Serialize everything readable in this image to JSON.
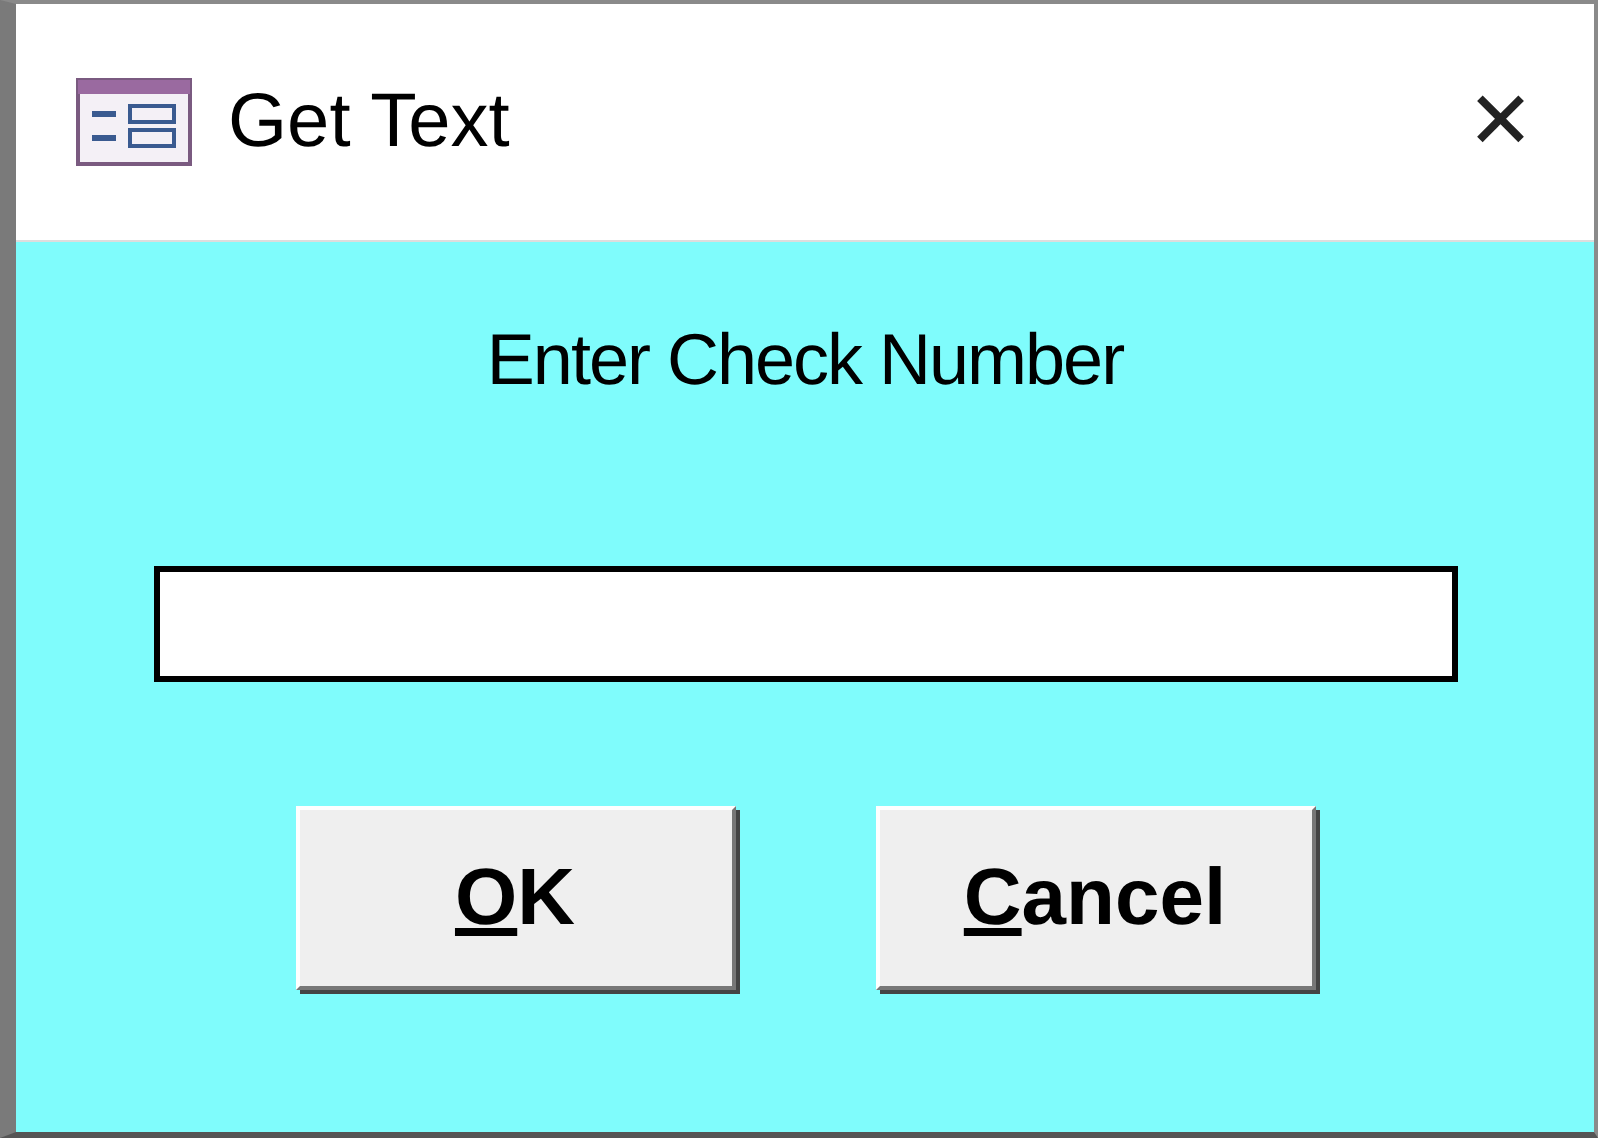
{
  "window": {
    "title": "Get Text",
    "close": "✕"
  },
  "prompt": "Enter Check Number",
  "buttons": [
    {
      "mnemonic": "O",
      "rest": "K"
    },
    {
      "mnemonic": "C",
      "rest": "ancel"
    }
  ]
}
